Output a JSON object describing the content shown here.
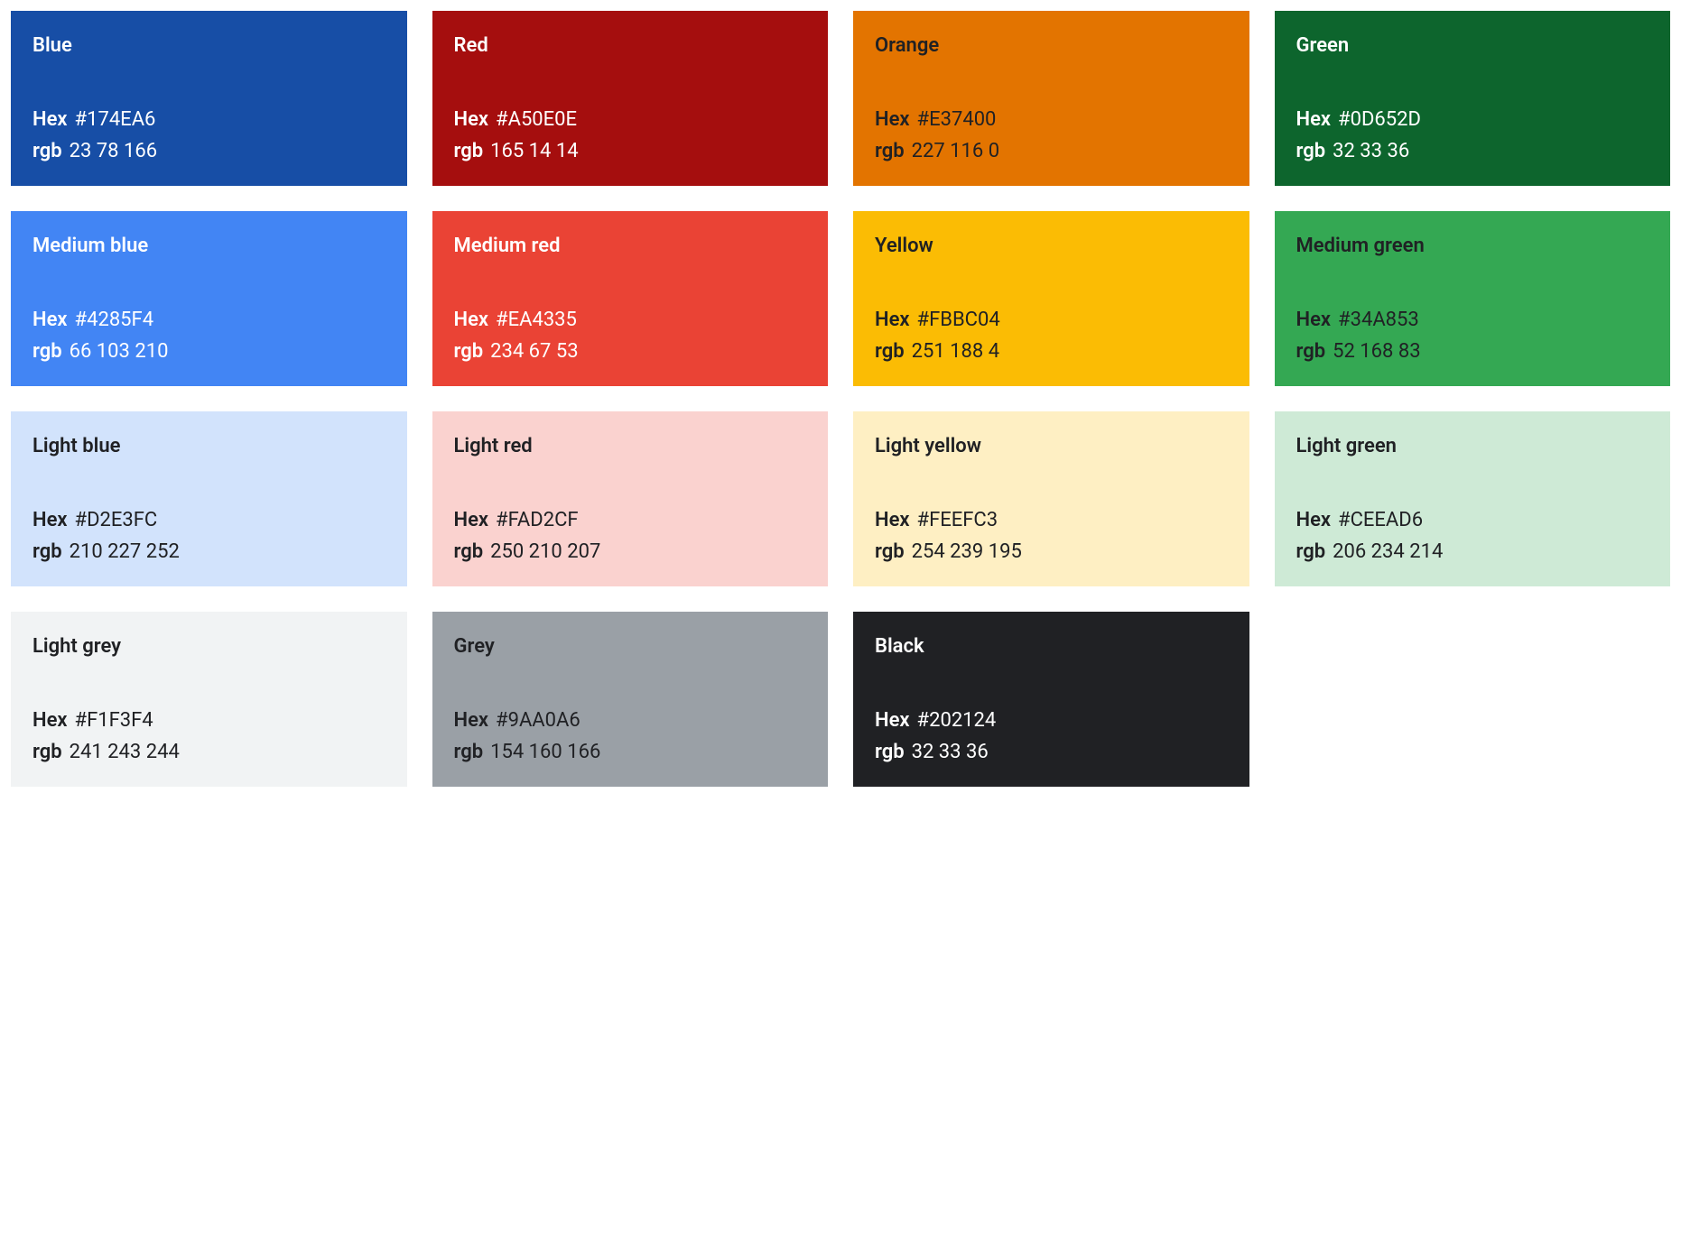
{
  "labels": {
    "hex": "Hex",
    "rgb": "rgb"
  },
  "swatches": [
    {
      "name": "Blue",
      "hex": "#174EA6",
      "rgb": "23 78 166",
      "bg": "#174EA6",
      "textClass": "text-light"
    },
    {
      "name": "Red",
      "hex": "#A50E0E",
      "rgb": "165 14 14",
      "bg": "#A50E0E",
      "textClass": "text-light"
    },
    {
      "name": "Orange",
      "hex": "#E37400",
      "rgb": "227 116 0",
      "bg": "#E37400",
      "textClass": "text-dark"
    },
    {
      "name": "Green",
      "hex": "#0D652D",
      "rgb": "32 33 36",
      "bg": "#0D652D",
      "textClass": "text-light"
    },
    {
      "name": "Medium blue",
      "hex": "#4285F4",
      "rgb": "66 103 210",
      "bg": "#4285F4",
      "textClass": "text-light"
    },
    {
      "name": "Medium red",
      "hex": "#EA4335",
      "rgb": "234 67 53",
      "bg": "#EA4335",
      "textClass": "text-light"
    },
    {
      "name": "Yellow",
      "hex": "#FBBC04",
      "rgb": "251 188 4",
      "bg": "#FBBC04",
      "textClass": "text-dark"
    },
    {
      "name": "Medium green",
      "hex": "#34A853",
      "rgb": "52 168 83",
      "bg": "#34A853",
      "textClass": "text-dark"
    },
    {
      "name": "Light blue",
      "hex": "#D2E3FC",
      "rgb": "210 227 252",
      "bg": "#D2E3FC",
      "textClass": "text-dark"
    },
    {
      "name": "Light red",
      "hex": "#FAD2CF",
      "rgb": "250 210 207",
      "bg": "#FAD2CF",
      "textClass": "text-dark"
    },
    {
      "name": "Light yellow",
      "hex": "#FEEFC3",
      "rgb": "254 239 195",
      "bg": "#FEEFC3",
      "textClass": "text-dark"
    },
    {
      "name": "Light green",
      "hex": "#CEEAD6",
      "rgb": "206 234 214",
      "bg": "#CEEAD6",
      "textClass": "text-dark"
    },
    {
      "name": "Light grey",
      "hex": "#F1F3F4",
      "rgb": "241 243 244",
      "bg": "#F1F3F4",
      "textClass": "text-dark"
    },
    {
      "name": "Grey",
      "hex": "#9AA0A6",
      "rgb": "154 160 166",
      "bg": "#9AA0A6",
      "textClass": "text-dark"
    },
    {
      "name": "Black",
      "hex": "#202124",
      "rgb": "32 33 36",
      "bg": "#202124",
      "textClass": "text-light"
    }
  ]
}
